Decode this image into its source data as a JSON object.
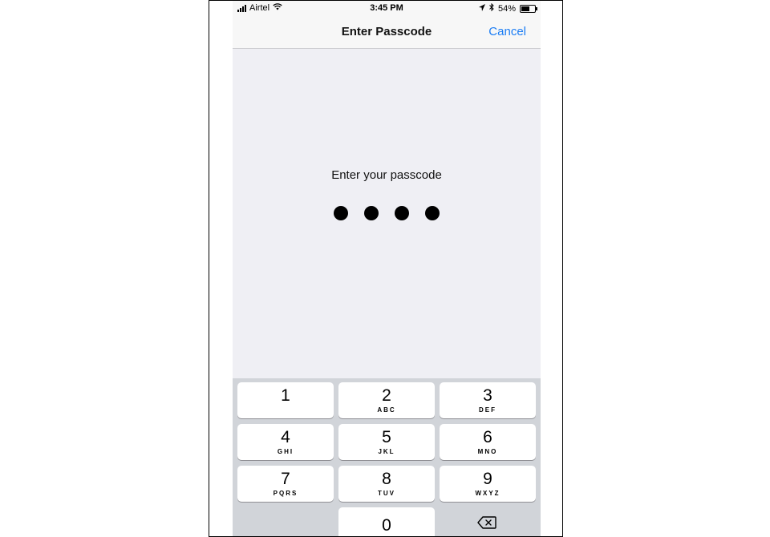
{
  "status_bar": {
    "carrier": "Airtel",
    "time": "3:45 PM",
    "battery_percent": "54%",
    "battery_level": 0.54,
    "icons": [
      "signal-icon",
      "wifi-icon",
      "location-icon",
      "bluetooth-icon",
      "battery-icon"
    ]
  },
  "nav": {
    "title": "Enter Passcode",
    "cancel_label": "Cancel",
    "accent_color": "#1a7cf4"
  },
  "prompt": {
    "text": "Enter your passcode",
    "dots_filled": 4
  },
  "keypad": {
    "keys": [
      {
        "num": "1",
        "letters": ""
      },
      {
        "num": "2",
        "letters": "ABC"
      },
      {
        "num": "3",
        "letters": "DEF"
      },
      {
        "num": "4",
        "letters": "GHI"
      },
      {
        "num": "5",
        "letters": "JKL"
      },
      {
        "num": "6",
        "letters": "MNO"
      },
      {
        "num": "7",
        "letters": "PQRS"
      },
      {
        "num": "8",
        "letters": "TUV"
      },
      {
        "num": "9",
        "letters": "WXYZ"
      },
      {
        "num": "0",
        "letters": ""
      }
    ],
    "backspace_icon": "backspace-icon"
  }
}
